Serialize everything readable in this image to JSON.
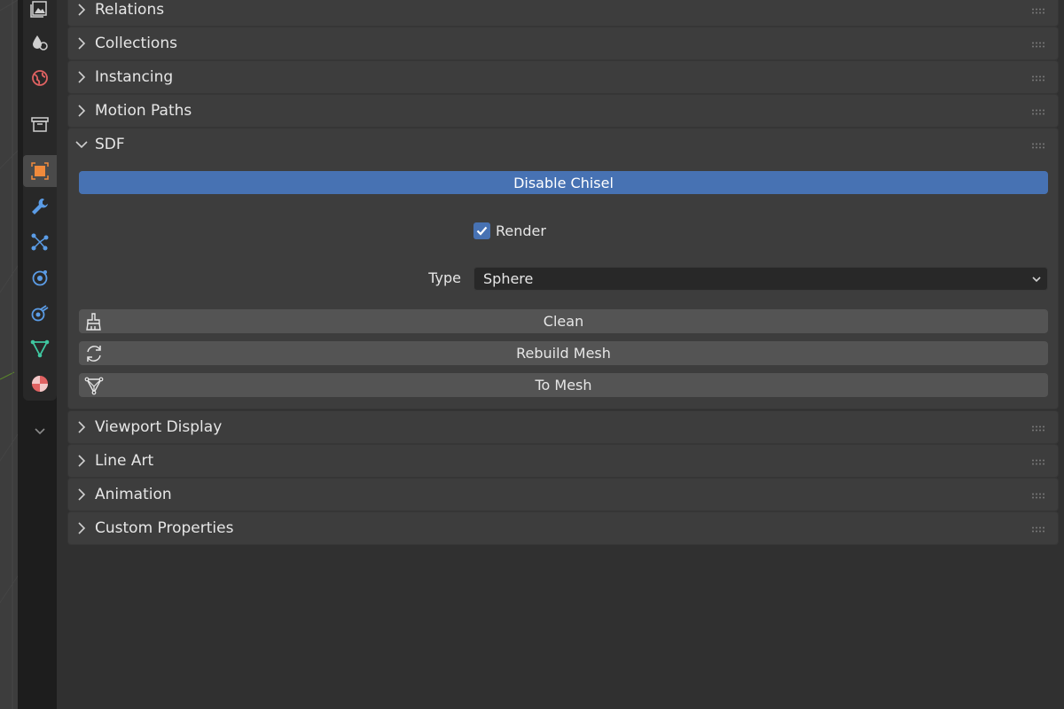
{
  "sidebar": {
    "tabs": [
      {
        "name": "tab-scene",
        "icon": "image-stack-icon"
      },
      {
        "name": "tab-particles-world",
        "icon": "droplets-icon"
      },
      {
        "name": "tab-world",
        "icon": "world-icon"
      },
      {
        "name": "tab-collection",
        "icon": "box-icon"
      },
      {
        "name": "tab-object",
        "icon": "object-icon",
        "active": true
      },
      {
        "name": "tab-modifiers",
        "icon": "wrench-icon"
      },
      {
        "name": "tab-particles",
        "icon": "particles-icon"
      },
      {
        "name": "tab-physics",
        "icon": "physics-icon"
      },
      {
        "name": "tab-constraints",
        "icon": "constraint-icon"
      },
      {
        "name": "tab-data",
        "icon": "mesh-data-icon"
      },
      {
        "name": "tab-material",
        "icon": "material-icon"
      }
    ],
    "more_icon": "chevron-down-icon"
  },
  "panels": {
    "relations": "Relations",
    "collections": "Collections",
    "instancing": "Instancing",
    "motion_paths": "Motion Paths",
    "sdf": "SDF",
    "viewport_display": "Viewport Display",
    "line_art": "Line Art",
    "animation": "Animation",
    "custom_properties": "Custom Properties"
  },
  "sdf": {
    "disable_button": "Disable Chisel",
    "render_label": "Render",
    "render_checked": true,
    "type_label": "Type",
    "type_value": "Sphere",
    "clean_button": "Clean",
    "rebuild_button": "Rebuild Mesh",
    "to_mesh_button": "To Mesh"
  },
  "colors": {
    "accent": "#4772b3",
    "panel": "#3d3d3d",
    "background": "#303030"
  }
}
